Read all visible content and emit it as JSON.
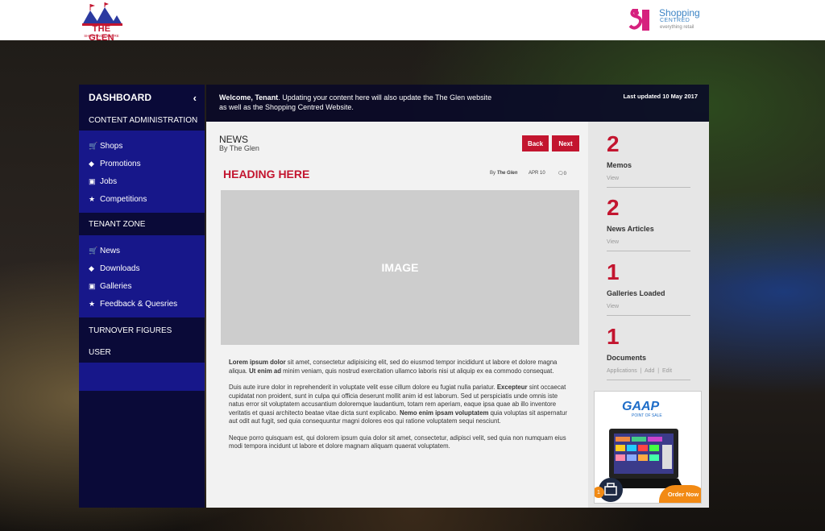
{
  "header": {
    "logo_left_text": "THE GLEN",
    "logo_left_sub": "SHOPPING CENTRE",
    "logo_right_title": "Shopping",
    "logo_right_sub": "CENTRED",
    "logo_right_tag": "everything retail"
  },
  "sidebar": {
    "title": "DASHBOARD",
    "collapse_icon": "chevron-left-icon",
    "sections": [
      {
        "label": "CONTENT ADMINISTRATION",
        "items": [
          {
            "label": "Shops",
            "icon": "cart-icon"
          },
          {
            "label": "Promotions",
            "icon": "tag-icon"
          },
          {
            "label": "Jobs",
            "icon": "briefcase-icon"
          },
          {
            "label": "Competitions",
            "icon": "trophy-icon"
          }
        ]
      },
      {
        "label": "TENANT ZONE",
        "items": [
          {
            "label": "News",
            "icon": "cart-icon"
          },
          {
            "label": "Downloads",
            "icon": "tag-icon"
          },
          {
            "label": "Galleries",
            "icon": "briefcase-icon"
          },
          {
            "label": "Feedback & Quesries",
            "icon": "trophy-icon"
          }
        ]
      },
      {
        "label": "TURNOVER FIGURES"
      },
      {
        "label": "USER"
      }
    ]
  },
  "welcome": {
    "bold": "Welcome, Tenant",
    "message": ". Updating your content here will also update the The Glen website as well as the Shopping Centred Website.",
    "last_updated": "Last updated 10 May 2017"
  },
  "news": {
    "title": "NEWS",
    "by": "By The Glen",
    "back_label": "Back",
    "next_label": "Next",
    "heading": "HEADING HERE",
    "meta_by": "By",
    "meta_author": "The Glen",
    "meta_date": "APR 10",
    "meta_comments": "0",
    "image_label": "IMAGE",
    "p1_b1": "Lorem ipsum dolor",
    "p1_t1": " sit amet, consectetur adipisicing elit, sed do eiusmod tempor incididunt ut labore et dolore magna aliqua. ",
    "p1_b2": "Ut enim ad",
    "p1_t2": " minim veniam, quis nostrud exercitation ullamco laboris nisi ut aliquip ex ea commodo consequat.",
    "p2_t1": "Duis aute irure dolor in reprehenderit in voluptate velit esse cillum dolore eu fugiat nulla pariatur. ",
    "p2_b1": "Excepteur",
    "p2_t2": " sint occaecat cupidatat non proident, sunt in culpa qui officia deserunt mollit anim id est laborum. Sed ut perspiciatis unde omnis iste natus error sit voluptatem accusantium doloremque laudantium, totam rem aperiam, eaque ipsa quae ab illo inventore veritatis et quasi architecto beatae vitae dicta sunt explicabo. ",
    "p2_b2": "Nemo enim ipsam voluptatem",
    "p2_t3": " quia voluptas sit aspernatur aut odit aut fugit, sed quia consequuntur magni dolores eos qui ratione voluptatem sequi nesciunt.",
    "p3": "Neque porro quisquam est, qui dolorem ipsum quia dolor sit amet, consectetur, adipisci velit, sed quia non numquam eius modi tempora incidunt ut labore et dolore magnam aliquam quaerat voluptatem."
  },
  "stats": [
    {
      "num": "2",
      "label": "Memos",
      "link": "View"
    },
    {
      "num": "2",
      "label": "News Articles",
      "link": "View"
    },
    {
      "num": "1",
      "label": "Galleries Loaded",
      "link": "View"
    },
    {
      "num": "1",
      "label": "Documents",
      "link": "Applications  |  Add  |  Edit"
    }
  ],
  "ad": {
    "brand": "GAAP",
    "sub": "POINT OF SALE",
    "order_label": "Order Now",
    "badge": "1"
  },
  "colors": {
    "accent": "#c3152f",
    "sidebar_dark": "#0a0a38",
    "sidebar_blue": "#17178a",
    "order_orange": "#f28a14"
  }
}
